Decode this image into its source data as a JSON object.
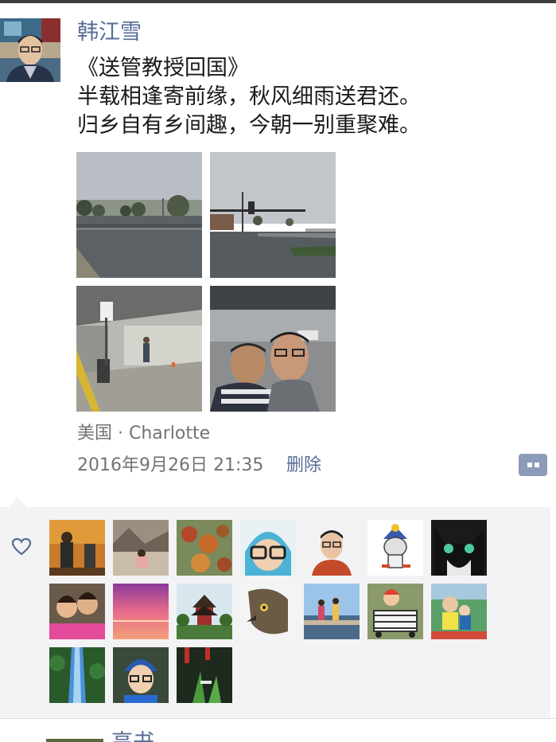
{
  "post": {
    "author": "韩江雪",
    "text": "《送管教授回国》\n半载相逢寄前缘，秋风细雨送君还。\n归乡自有乡间趣，今朝一别重聚难。",
    "location": "美国 · Charlotte",
    "timestamp": "2016年9月26日 21:35",
    "delete_label": "删除",
    "photo_count": 4,
    "likes_count": 17
  },
  "next_post": {
    "author_partial": "高书"
  },
  "icons": {
    "heart": "heart-icon",
    "comment": "comment-more-icon"
  },
  "colors": {
    "link": "#576b95",
    "meta_text": "#737373",
    "like_area_bg": "#f3f3f5",
    "comment_button_bg": "#8c9bb8"
  }
}
